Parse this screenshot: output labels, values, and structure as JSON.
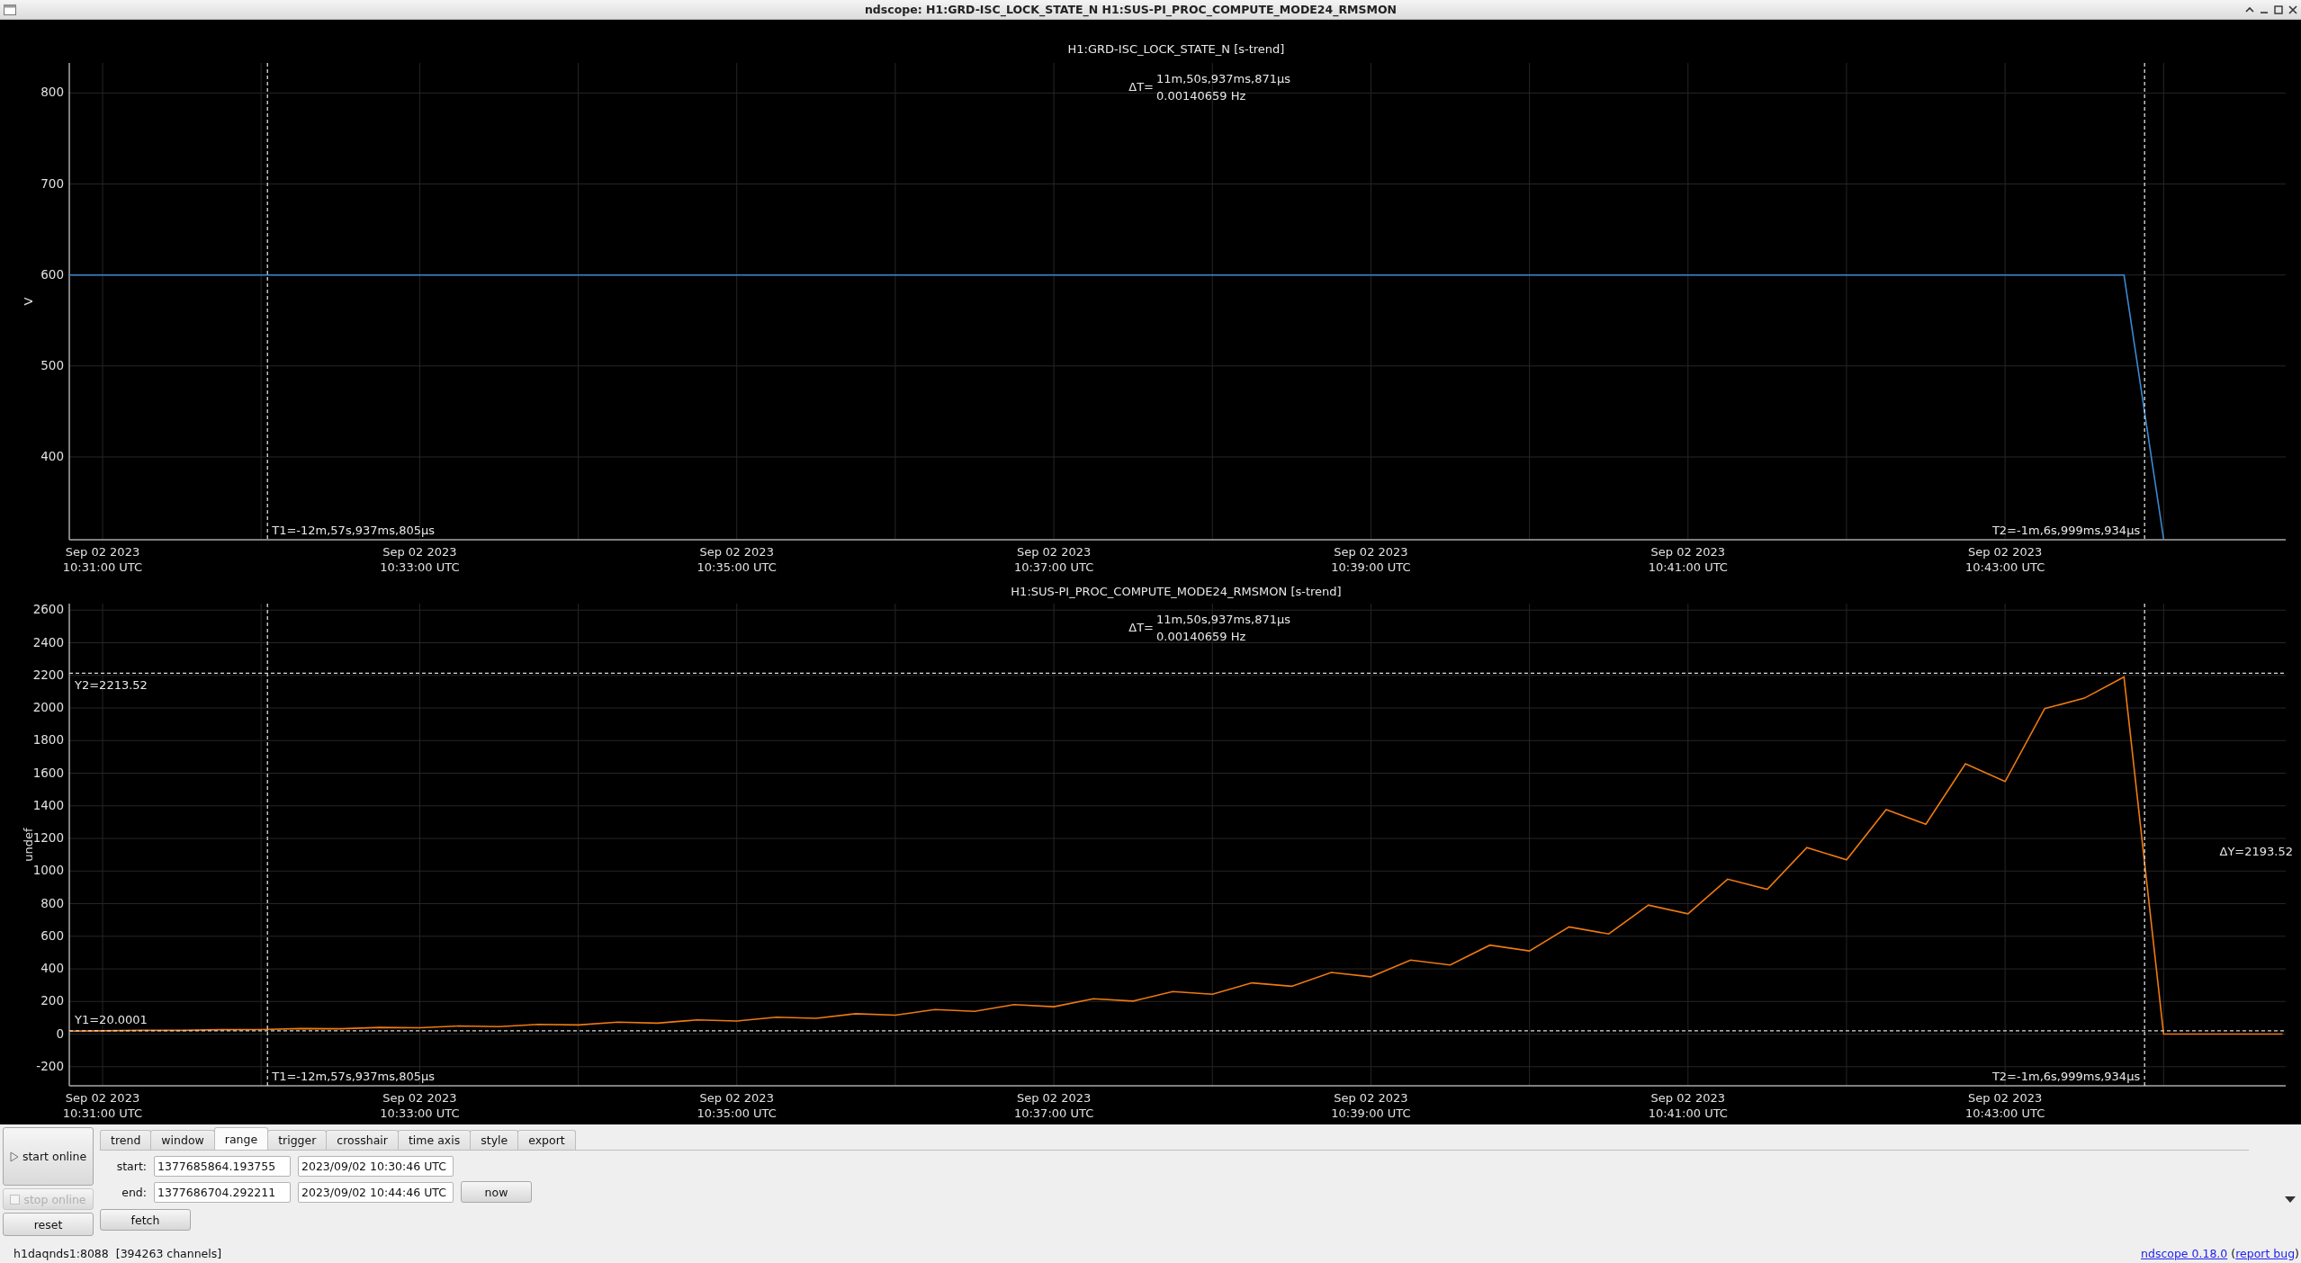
{
  "window": {
    "title": "ndscope: H1:GRD-ISC_LOCK_STATE_N H1:SUS-PI_PROC_COMPUTE_MODE24_RMSMON"
  },
  "plots": [
    {
      "chart_data": {
        "type": "line",
        "title": "H1:GRD-ISC_LOCK_STATE_N [s-trend]",
        "ylabel": "V",
        "ylim": [
          309,
          833
        ],
        "grid": true,
        "categories": [
          null,
          "Sep 02 2023 10:31:00 UTC",
          null,
          null,
          null,
          null,
          null,
          null,
          null,
          "Sep 02 2023 10:33:00 UTC",
          null,
          null,
          null,
          null,
          null,
          null,
          null,
          "Sep 02 2023 10:35:00 UTC",
          null,
          null,
          null,
          null,
          null,
          null,
          null,
          "Sep 02 2023 10:37:00 UTC",
          null,
          null,
          null,
          null,
          null,
          null,
          null,
          "Sep 02 2023 10:39:00 UTC",
          null,
          null,
          null,
          null,
          null,
          null,
          null,
          "Sep 02 2023 10:41:00 UTC",
          null,
          null,
          null,
          null,
          null,
          null,
          null,
          "Sep 02 2023 10:43:00 UTC",
          null,
          null,
          null,
          null,
          null,
          null,
          null
        ],
        "series": [
          {
            "color": "#3c8ad0",
            "values": [
              600,
              600,
              600,
              600,
              600,
              600,
              600,
              600,
              600,
              600,
              600,
              600,
              600,
              600,
              600,
              600,
              600,
              600,
              600,
              600,
              600,
              600,
              600,
              600,
              600,
              600,
              600,
              600,
              600,
              600,
              600,
              600,
              600,
              600,
              600,
              600,
              600,
              600,
              600,
              600,
              600,
              600,
              600,
              600,
              600,
              600,
              600,
              600,
              600,
              600,
              600,
              600,
              600,
              310,
              null,
              null,
              null
            ]
          }
        ],
        "yticks": [
          400,
          500,
          600,
          700,
          800
        ]
      },
      "time_cursors": [
        "T1=-12m,57s,937ms,805μs",
        "T2=-1m,6s,999ms,934μs"
      ],
      "delta_t": {
        "symbol": "ΔT=",
        "interval": "11m,50s,937ms,871μs",
        "frequency": "0.00140659 Hz"
      }
    },
    {
      "chart_data": {
        "type": "line",
        "title": "H1:SUS-PI_PROC_COMPUTE_MODE24_RMSMON [s-trend]",
        "ylabel": "undef",
        "ylim": [
          -317,
          2640
        ],
        "grid": true,
        "categories": [
          null,
          "Sep 02 2023 10:31:00 UTC",
          null,
          null,
          null,
          null,
          null,
          null,
          null,
          "Sep 02 2023 10:33:00 UTC",
          null,
          null,
          null,
          null,
          null,
          null,
          null,
          "Sep 02 2023 10:35:00 UTC",
          null,
          null,
          null,
          null,
          null,
          null,
          null,
          "Sep 02 2023 10:37:00 UTC",
          null,
          null,
          null,
          null,
          null,
          null,
          null,
          "Sep 02 2023 10:39:00 UTC",
          null,
          null,
          null,
          null,
          null,
          null,
          null,
          "Sep 02 2023 10:41:00 UTC",
          null,
          null,
          null,
          null,
          null,
          null,
          null,
          "Sep 02 2023 10:43:00 UTC",
          null,
          null,
          null,
          null,
          null,
          null,
          null
        ],
        "series": [
          {
            "color": "#f07a10",
            "values": [
              18,
              20,
              23,
              23,
              27,
              28,
              34,
              33,
              41,
              39,
              50,
              46,
              60,
              56,
              73,
              67,
              87,
              80,
              104,
              97,
              125,
              116,
              150,
              140,
              181,
              168,
              217,
              202,
              261,
              244,
              314,
              293,
              378,
              351,
              454,
              424,
              545,
              510,
              657,
              614,
              791,
              737,
              950,
              888,
              1144,
              1069,
              1377,
              1287,
              1658,
              1549,
              1996,
              2060,
              2190,
              0,
              0,
              0,
              0
            ]
          }
        ],
        "yticks": [
          -200,
          0,
          200,
          400,
          600,
          800,
          1000,
          1200,
          1400,
          1600,
          1800,
          2000,
          2200,
          2400,
          2600
        ],
        "ref_lines": [
          {
            "axis": "y",
            "value": 2213.52,
            "label": "Y2=2213.52"
          },
          {
            "axis": "y",
            "value": 20.0001,
            "label": "Y1=20.0001"
          }
        ]
      },
      "time_cursors": [
        "T1=-12m,57s,937ms,805μs",
        "T2=-1m,6s,999ms,934μs"
      ],
      "delta_t": {
        "symbol": "ΔT=",
        "interval": "11m,50s,937ms,871μs",
        "frequency": "0.00140659 Hz"
      },
      "delta_y": "ΔY=2193.52"
    }
  ],
  "controls": {
    "side_buttons": [
      {
        "label": "start online",
        "kind": "play",
        "disabled": false
      },
      {
        "label": "stop online",
        "kind": "check",
        "disabled": true
      },
      {
        "label": "reset",
        "kind": "plain",
        "disabled": false
      }
    ],
    "tabs": [
      {
        "label": "trend",
        "selected": false
      },
      {
        "label": "window",
        "selected": false
      },
      {
        "label": "range",
        "selected": true
      },
      {
        "label": "trigger",
        "selected": false
      },
      {
        "label": "crosshair",
        "selected": false
      },
      {
        "label": "time axis",
        "selected": false
      },
      {
        "label": "style",
        "selected": false
      },
      {
        "label": "export",
        "selected": false
      }
    ],
    "range": {
      "rows": [
        {
          "label": "start:",
          "gps": "1377685864.193755",
          "utc": "2023/09/02 10:30:46 UTC"
        },
        {
          "label": "end:",
          "gps": "1377686704.292211",
          "utc": "2023/09/02 10:44:46 UTC"
        }
      ],
      "now_button": "now",
      "fetch_button": "fetch"
    }
  },
  "status": {
    "server": "h1daqnds1:8088",
    "channels": "[394263 channels]"
  },
  "footer": {
    "version": "ndscope 0.18.0",
    "open": "(",
    "bug": "report bug",
    "close": ")"
  }
}
